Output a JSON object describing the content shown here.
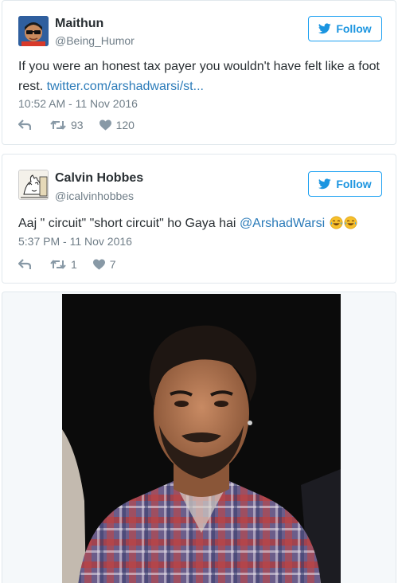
{
  "tweets": [
    {
      "name": "Maithun",
      "handle": "@Being_Humor",
      "follow_label": "Follow",
      "text": "If you were an honest tax payer you wouldn't have felt like a foot rest. ",
      "link": "twitter.com/arshadwarsi/st...",
      "timestamp": "10:52 AM - 11 Nov 2016",
      "retweets": "93",
      "likes": "120"
    },
    {
      "name": "Calvin Hobbes",
      "handle": "@icalvinhobbes",
      "follow_label": "Follow",
      "text": "Aaj \" circuit\" \"short circuit\" ho Gaya hai ",
      "mention": "@ArshadWarsi",
      "timestamp": "5:37 PM - 11 Nov 2016",
      "retweets": "1",
      "likes": "7"
    }
  ],
  "icons": {
    "follow": "twitter-bird-icon",
    "reply": "reply-icon",
    "retweet": "retweet-icon",
    "like": "heart-icon",
    "emoji": "tears-of-joy-emoji-icon"
  },
  "colors": {
    "accent": "#1b95e0",
    "link": "#2b7bb9",
    "muted": "#707e88",
    "border": "#e1e8ed"
  }
}
